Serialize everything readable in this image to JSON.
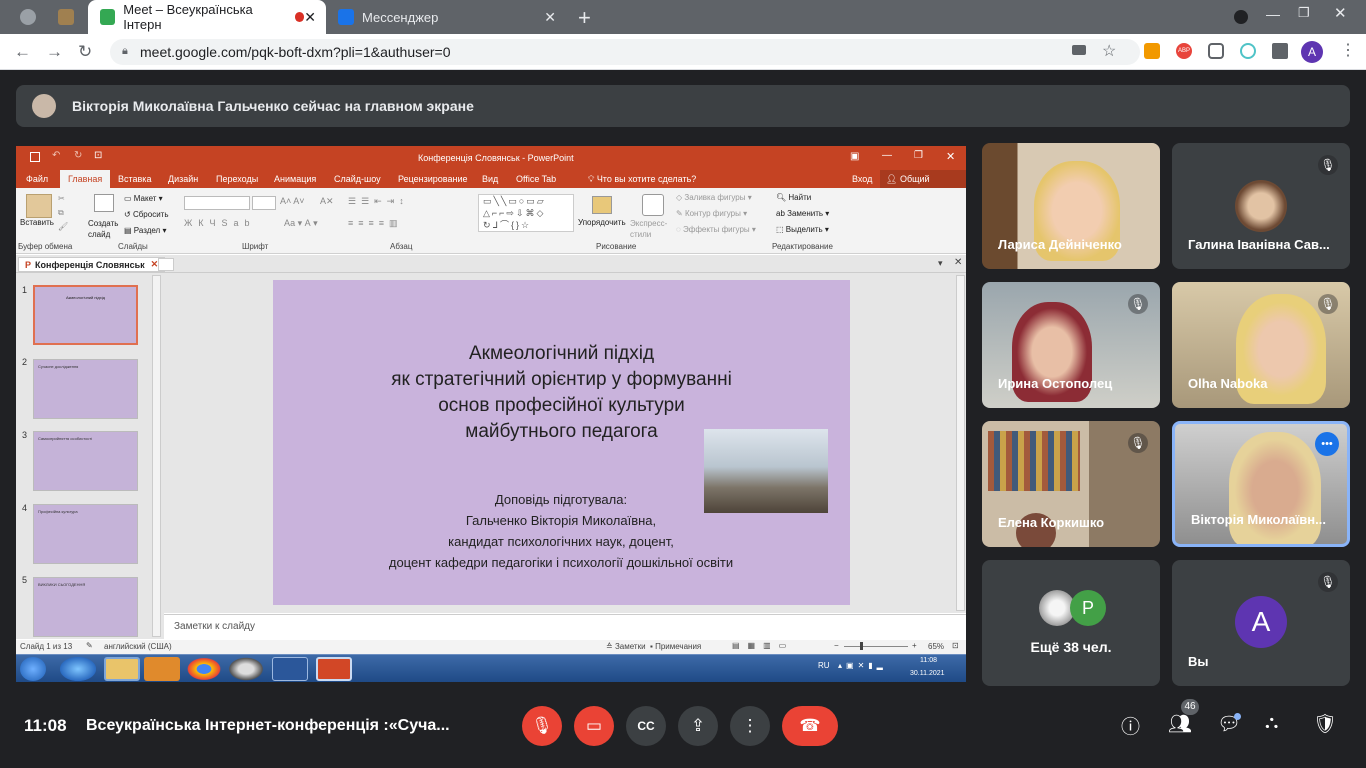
{
  "browser": {
    "tabs": [
      {
        "title": "Meet – Всеукраїнська Інтерн"
      },
      {
        "title": "Мессенджер"
      }
    ],
    "url": "meet.google.com/pqk-boft-dxm?pli=1&authuser=0",
    "extensions": [
      "ABP"
    ],
    "profile_initial": "A",
    "colors": {
      "accent": "#1a73e8",
      "tabstrip": "#5f6368"
    }
  },
  "banner": {
    "text": "Вікторія Миколаївна Гальченко сейчас на главном экране"
  },
  "powerpoint": {
    "window_title": "Конференція Словянськ - PowerPoint",
    "ribbon_tabs": [
      "Файл",
      "Главная",
      "Вставка",
      "Дизайн",
      "Переходы",
      "Анимация",
      "Слайд-шоу",
      "Рецензирование",
      "Вид",
      "Office Tab"
    ],
    "tell_me": "Что вы хотите сделать?",
    "signin": "Вход",
    "share": "Общий доступ",
    "groups": [
      "Буфер обмена",
      "Слайды",
      "Шрифт",
      "Абзац",
      "Рисование",
      "Редактирование"
    ],
    "buttons": {
      "paste": "Вставить",
      "new_slide": "Создать слайд",
      "layout": "Макет",
      "reset": "Сбросить",
      "section": "Раздел",
      "arrange": "Упорядочить",
      "quick_styles": "Экспресс-стили",
      "fill": "Заливка фигуры",
      "outline": "Контур фигуры",
      "effects": "Эффекты фигуры",
      "find": "Найти",
      "replace": "Заменить",
      "select": "Выделить"
    },
    "doc_tab": "Конференція Словянськ",
    "thumbs": [
      "1",
      "2",
      "3",
      "4",
      "5"
    ],
    "thumb_titles": [
      "Акмеологічний підхід",
      "Сучасне дослідження",
      "Самосприйняття особистості",
      "Професійна культура",
      "ВИКЛИКИ СЬОГОДЕННЯ"
    ],
    "slide": {
      "title_lines": [
        "Акмеологічний підхід",
        "як стратегічний орієнтир у формуванні",
        "основ професійної культури",
        "майбутнього педагога"
      ],
      "author_lines": [
        "Доповідь підготувала:",
        "Гальченко Вікторія Миколаївна,",
        "кандидат психологічних наук, доцент,",
        "доцент кафедри педагогіки і психології дошкільної освіти"
      ]
    },
    "notes_placeholder": "Заметки к слайду",
    "status": {
      "slide_counter": "Слайд 1 из 13",
      "language": "английский (США)",
      "notes": "Заметки",
      "comments": "Примечания",
      "zoom": "65%"
    },
    "taskbar": {
      "lang": "RU",
      "time": "11:08",
      "date": "30.11.2021"
    }
  },
  "participants": [
    {
      "name": "Лариса Дейнiченко",
      "muted": false
    },
    {
      "name": "Галина Іванівна Сав...",
      "muted": true
    },
    {
      "name": "Ирина Остополец",
      "muted": true
    },
    {
      "name": "Olha Naboka",
      "muted": true
    },
    {
      "name": "Елена Коркишко",
      "muted": true
    },
    {
      "name": "Вікторія Миколаївн...",
      "muted": false,
      "speaking": true
    }
  ],
  "more_tile": {
    "label": "Ещё 38 чел.",
    "initial": "P"
  },
  "self_tile": {
    "label": "Вы",
    "initial": "A",
    "muted": true
  },
  "bottom": {
    "time": "11:08",
    "meeting_title": "Всеукраїнська Інтернет-конференція :«Суча...",
    "people_count": "46",
    "colors": {
      "end_call": "#ea4335",
      "self_avatar": "#5e35b1",
      "more_avatar": "#43a047"
    }
  }
}
